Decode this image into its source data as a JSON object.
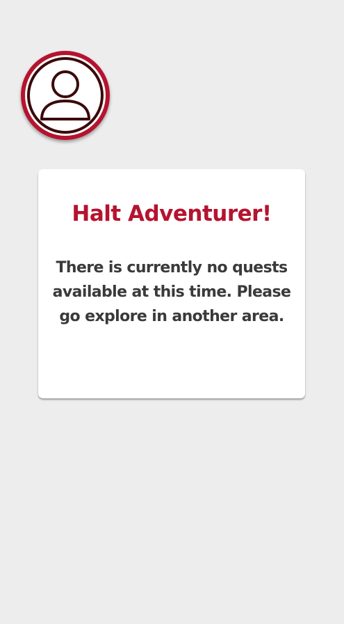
{
  "avatar": {
    "icon": "user-profile-icon"
  },
  "notice": {
    "title": "Halt Adventurer!",
    "message": "There is currently no quests available at this time. Please go explore in another area."
  },
  "colors": {
    "background": "#ededed",
    "accent": "#b5132f",
    "card": "#ffffff",
    "text": "#3a3a3a",
    "icon_stroke": "#3b0a0a"
  }
}
